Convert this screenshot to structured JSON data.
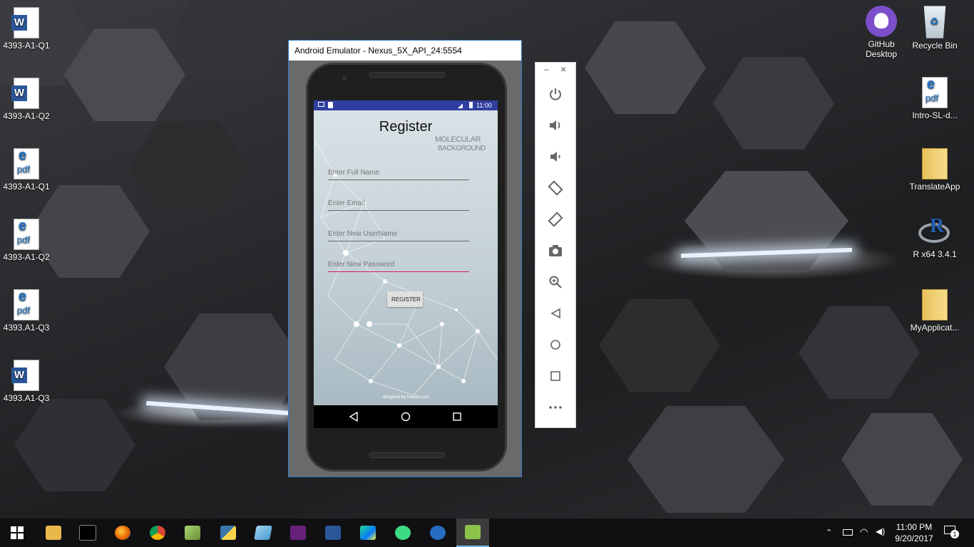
{
  "desktop": {
    "left_icons": [
      {
        "label": "4393-A1-Q1",
        "type": "word"
      },
      {
        "label": "4393-A1-Q2",
        "type": "word"
      },
      {
        "label": "4393-A1-Q1",
        "type": "pdf"
      },
      {
        "label": "4393-A1-Q2",
        "type": "pdf"
      },
      {
        "label": "4393.A1-Q3",
        "type": "pdf"
      },
      {
        "label": "4393.A1-Q3",
        "type": "word"
      }
    ],
    "right_icons": [
      {
        "label": "GitHub Desktop",
        "type": "github"
      },
      {
        "label": "Recycle Bin",
        "type": "recycle-bin"
      },
      {
        "label": "Intro-SL-d...",
        "type": "pdf"
      },
      {
        "label": "TranslateApp",
        "type": "folder"
      },
      {
        "label": "R x64 3.4.1",
        "type": "r"
      },
      {
        "label": "MyApplicat...",
        "type": "folder"
      }
    ]
  },
  "emulator": {
    "window_title": "Android Emulator - Nexus_5X_API_24:5554",
    "status_time": "11:00",
    "app": {
      "title": "Register",
      "bg_caption_1": "MOLECULAR",
      "bg_caption_2": "BACKGROUND",
      "fields": [
        {
          "placeholder": "Enter Full Name"
        },
        {
          "placeholder": "Enter Email"
        },
        {
          "placeholder": "Enter New UserName"
        },
        {
          "placeholder": "Enter New Password"
        }
      ],
      "register_button": "REGISTER",
      "credit": "designed by freepik.com"
    },
    "toolbar": {
      "minimize": "–",
      "close": "×",
      "buttons": [
        "power-icon",
        "volume-up-icon",
        "volume-down-icon",
        "rotate-left-icon",
        "rotate-right-icon",
        "camera-icon",
        "zoom-icon",
        "back-icon",
        "home-icon",
        "overview-icon",
        "more-icon"
      ]
    }
  },
  "taskbar": {
    "apps": [
      "start",
      "file-explorer",
      "command-prompt",
      "firefox",
      "chrome",
      "tools",
      "python",
      "notepad",
      "visual-studio",
      "word",
      "webstorm",
      "android-studio",
      "r",
      "emulator"
    ],
    "time": "11:00 PM",
    "date": "9/20/2017",
    "notification_count": "1"
  },
  "colors": {
    "accent_statusbar": "#303f9f",
    "window_border": "#2e7bcf",
    "password_underline": "#d81b60"
  }
}
